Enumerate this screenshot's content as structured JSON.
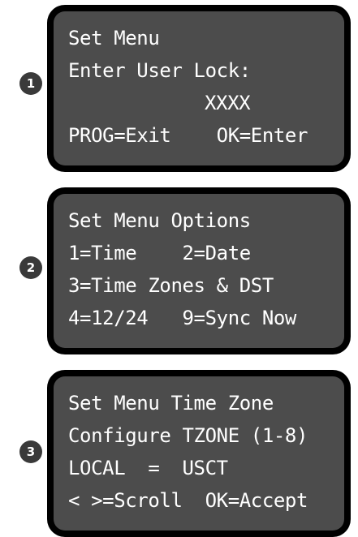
{
  "colors": {
    "bezel": "#000000",
    "screen": "#4c4c4c",
    "text": "#ffffff",
    "badge": "#3a3a3a"
  },
  "steps": [
    {
      "number": "1",
      "lines": [
        "Set Menu",
        "Enter User Lock:",
        "XXXX",
        "PROG=Exit    OK=Enter"
      ]
    },
    {
      "number": "2",
      "lines": [
        "Set Menu Options",
        "1=Time    2=Date",
        "3=Time Zones & DST",
        "4=12/24   9=Sync Now"
      ]
    },
    {
      "number": "3",
      "lines": [
        "Set Menu Time Zone",
        "Configure TZONE (1-8)",
        "LOCAL  =  USCT",
        "< >=Scroll  OK=Accept"
      ]
    }
  ]
}
